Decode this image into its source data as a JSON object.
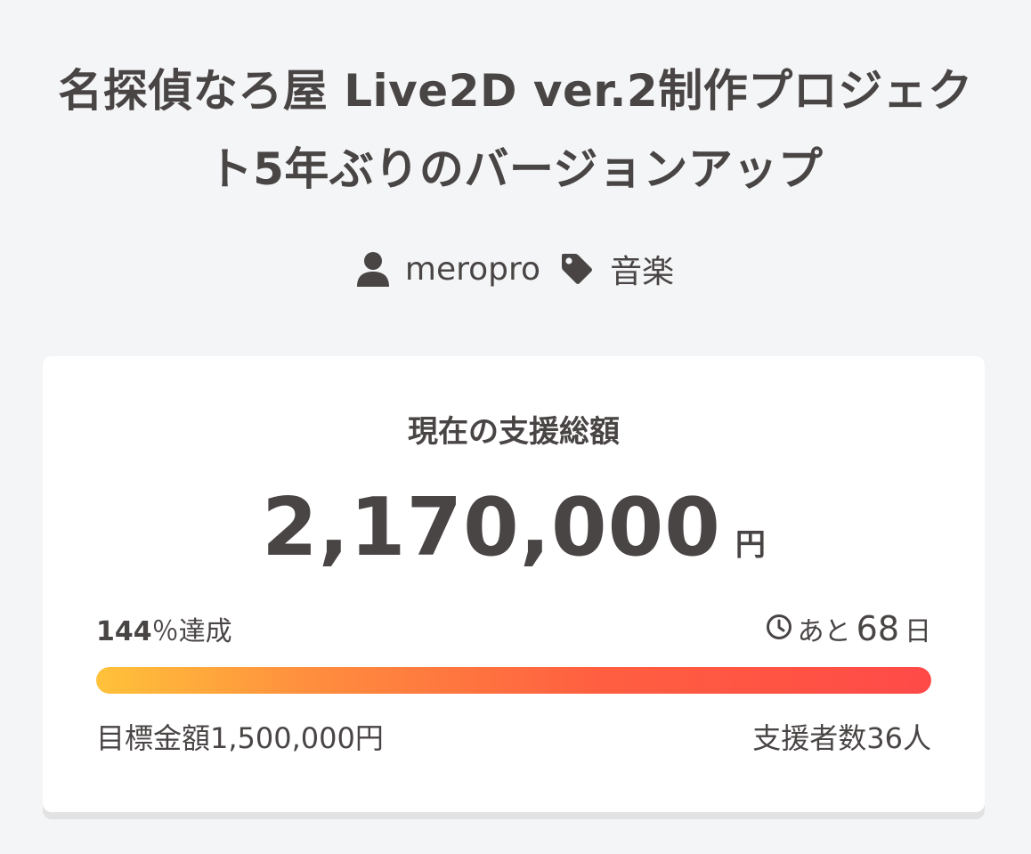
{
  "project": {
    "title": "名探偵なろ屋 Live2D ver.2制作プロジェクト5年ぶりのバージョンアップ",
    "author": "meropro",
    "category": "音楽"
  },
  "funding": {
    "label": "現在の支援総額",
    "amount": "2,170,000",
    "currency": "円",
    "achieved_pct": "144",
    "achieved_suffix": "％達成",
    "progress_fraction": 1.0,
    "remaining_prefix": "あと",
    "remaining_days": "68",
    "remaining_suffix": "日",
    "goal_text": "目標金額1,500,000円",
    "backers_text": "支援者数36人"
  },
  "colors": {
    "progress_start": "#ffc23a",
    "progress_end": "#ff4a48",
    "text": "#4a4545",
    "background": "#f4f5f7"
  },
  "icons": {
    "author": "user-icon",
    "category": "tag-icon",
    "remaining": "clock-icon"
  }
}
